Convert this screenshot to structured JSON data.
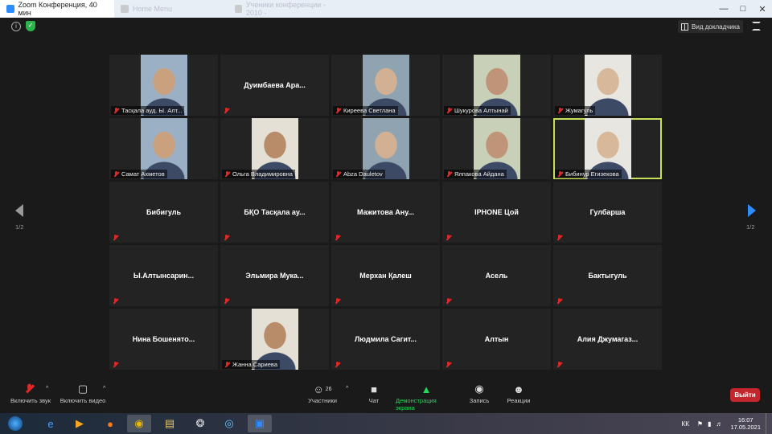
{
  "window": {
    "title": "Zoom Конференция, 40 мин",
    "tab2": "Home Menu",
    "tab3": "Ученики конференции - 2010 -"
  },
  "top": {
    "speaker_view": "Вид докладчика"
  },
  "grid": {
    "tiles": [
      {
        "name": "Тасқала ауд. Ы. Алт...",
        "video": true,
        "center": false
      },
      {
        "name": "Дуимбаева Ара...",
        "video": false,
        "center": true
      },
      {
        "name": "Киреева Светлана",
        "video": true,
        "center": false
      },
      {
        "name": "Шукурова Алтынай",
        "video": true,
        "center": false
      },
      {
        "name": "Жумагуль",
        "video": true,
        "center": false
      },
      {
        "name": "Самат Ахметов",
        "video": true,
        "center": false
      },
      {
        "name": "Ольга Владимировна",
        "video": true,
        "center": false
      },
      {
        "name": "Abza Dauletov",
        "video": true,
        "center": false
      },
      {
        "name": "Ялпакова Айдана",
        "video": true,
        "center": false
      },
      {
        "name": "Бибинур Егизекова",
        "video": true,
        "center": false,
        "active": true
      },
      {
        "name": "Бибигуль",
        "video": false,
        "center": true
      },
      {
        "name": "БҚО Тасқала ау...",
        "video": false,
        "center": true
      },
      {
        "name": "Мажитова Ану...",
        "video": false,
        "center": true
      },
      {
        "name": "IPHONE Цой",
        "video": false,
        "center": true
      },
      {
        "name": "Гулбарша",
        "video": false,
        "center": true
      },
      {
        "name": "Ы.Алтынсарин...",
        "video": false,
        "center": true
      },
      {
        "name": "Эльмира Мука...",
        "video": false,
        "center": true
      },
      {
        "name": "Мерхан Қалеш",
        "video": false,
        "center": true
      },
      {
        "name": "Асель",
        "video": false,
        "center": true
      },
      {
        "name": "Бактыгуль",
        "video": false,
        "center": true
      },
      {
        "name": "Нина Бошенято...",
        "video": false,
        "center": true
      },
      {
        "name": "Жанна Сариева",
        "video": true,
        "center": false
      },
      {
        "name": "Людмила Сагит...",
        "video": false,
        "center": true
      },
      {
        "name": "Алтын",
        "video": false,
        "center": true
      },
      {
        "name": "Алия Джумагаз...",
        "video": false,
        "center": true
      }
    ],
    "page_left": "1/2",
    "page_right": "1/2"
  },
  "toolbar": {
    "mic_label": "Включить звук",
    "video_label": "Включить видео",
    "participants_label": "Участники",
    "participants_count": "26",
    "chat_label": "Чат",
    "share_label": "Демонстрация экрана",
    "record_label": "Запись",
    "reactions_label": "Реакции",
    "leave_label": "Выйти"
  },
  "taskbar": {
    "lang": "КК",
    "time": "16:07",
    "date": "17.05.2021"
  },
  "colors": {
    "accent": "#2d8cff",
    "share_green": "#23d959",
    "leave_red": "#c4262d",
    "active_border": "#c6e05a"
  }
}
